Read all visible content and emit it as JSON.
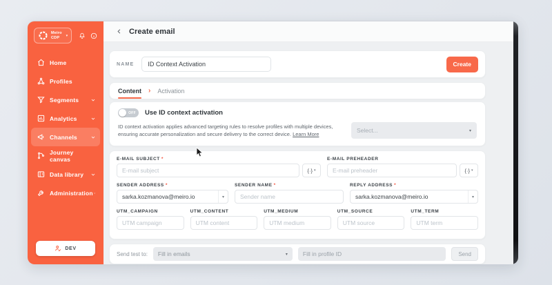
{
  "sidebar": {
    "logo_line1": "Meiro",
    "logo_line2": "CDP",
    "items": [
      {
        "label": "Home",
        "has_chevron": false,
        "active": false
      },
      {
        "label": "Profiles",
        "has_chevron": false,
        "active": false
      },
      {
        "label": "Segments",
        "has_chevron": true,
        "active": false
      },
      {
        "label": "Analytics",
        "has_chevron": true,
        "active": false
      },
      {
        "label": "Channels",
        "has_chevron": true,
        "active": true
      },
      {
        "label": "Journey canvas",
        "has_chevron": false,
        "active": false
      },
      {
        "label": "Data library",
        "has_chevron": true,
        "active": false
      },
      {
        "label": "Administration",
        "has_chevron": true,
        "active": false
      }
    ],
    "dev_label": "DEV"
  },
  "header": {
    "title": "Create email"
  },
  "name_row": {
    "label": "NAME",
    "value": "ID Context Activation",
    "create_label": "Create"
  },
  "tabs": {
    "content": "Content",
    "activation": "Activation"
  },
  "id_context": {
    "toggle_state": "OFF",
    "title": "Use ID context activation",
    "description": "ID context activation applies advanced targeting rules to resolve profiles with multiple devices, ensuring accurate personalization and secure delivery to the correct device. ",
    "link_label": "Learn More",
    "select_placeholder": "Select..."
  },
  "form": {
    "required_mark": "*",
    "subject": {
      "label": "E-MAIL SUBJECT",
      "placeholder": "E-mail subject"
    },
    "preheader": {
      "label": "E-MAIL PREHEADER",
      "placeholder": "E-mail preheader"
    },
    "sender_address": {
      "label": "SENDER ADDRESS",
      "value": "sarka.kozmanova@meiro.io"
    },
    "sender_name": {
      "label": "SENDER NAME",
      "placeholder": "Sender name"
    },
    "reply_address": {
      "label": "REPLY ADDRESS",
      "value": "sarka.kozmanova@meiro.io"
    },
    "utm": [
      {
        "label": "UTM_CAMPAIGN",
        "placeholder": "UTM campaign"
      },
      {
        "label": "UTM_CONTENT",
        "placeholder": "UTM content"
      },
      {
        "label": "UTM_MEDIUM",
        "placeholder": "UTM medium"
      },
      {
        "label": "UTM_SOURCE",
        "placeholder": "UTM source"
      },
      {
        "label": "UTM_TERM",
        "placeholder": "UTM term"
      }
    ]
  },
  "send_test": {
    "label": "Send test to:",
    "emails_placeholder": "Fill in emails",
    "profile_placeholder": "Fill in profile ID",
    "send_label": "Send"
  },
  "icons": {
    "variable": "{·}",
    "caret": "▾",
    "tab_separator": "›"
  },
  "colors": {
    "sidebar": "#f96240",
    "accent": "#f8694a",
    "content_bg": "#eef0f2",
    "disabled_bg": "#e8eaed"
  }
}
